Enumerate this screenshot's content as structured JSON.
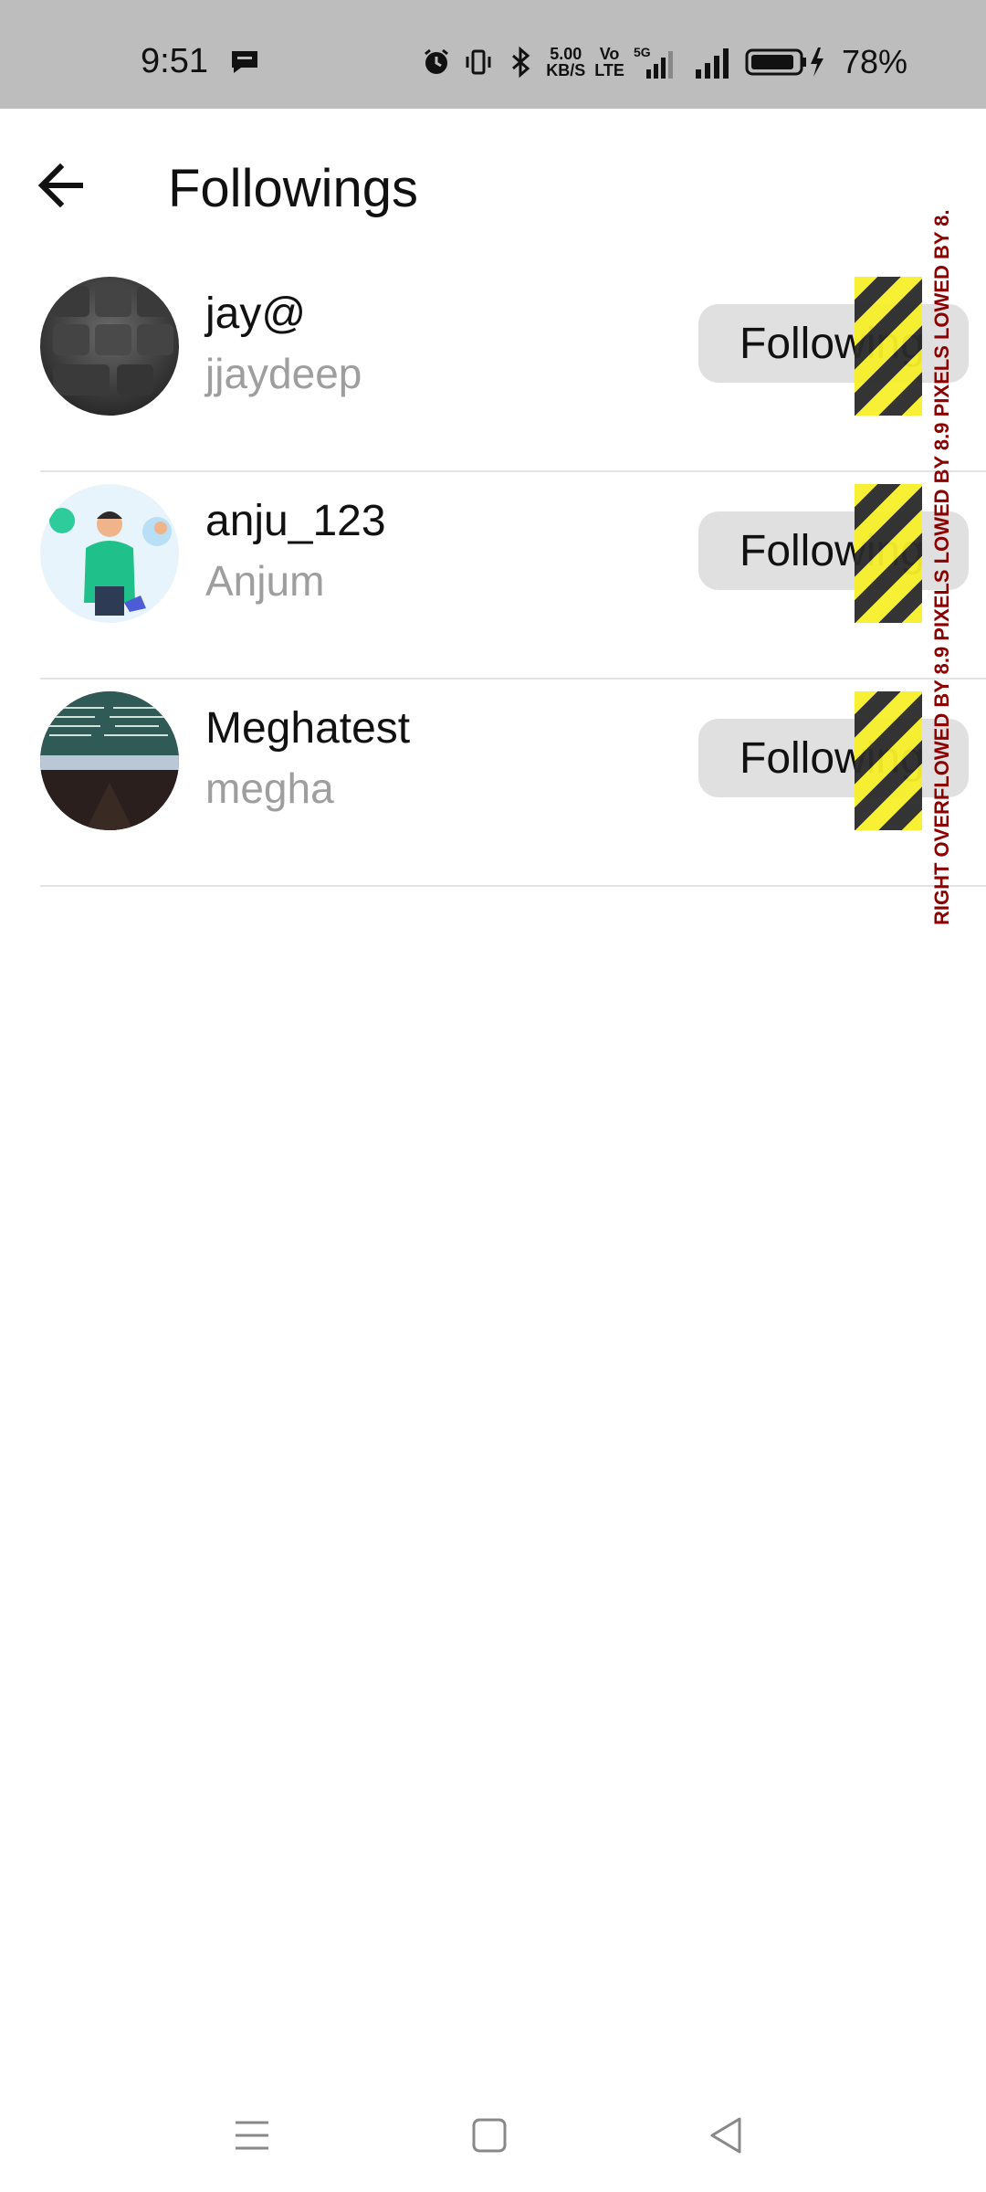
{
  "status_bar": {
    "time": "9:51",
    "speed_top": "5.00",
    "speed_bottom": "KB/S",
    "volte_top": "Vo",
    "volte_bottom": "LTE",
    "network": "5G",
    "battery_pct": "78%"
  },
  "header": {
    "title": "Followings"
  },
  "followings": [
    {
      "username": "jay@",
      "display_name": "jjaydeep",
      "button": "Following"
    },
    {
      "username": "anju_123",
      "display_name": "Anjum",
      "button": "Following"
    },
    {
      "username": "Meghatest",
      "display_name": "megha",
      "button": "Following"
    }
  ],
  "debug_overflow": {
    "text": "RIGHT OVERFLOWED BY 8.9 PIXELS LOWED BY 8.9 PIXELS LOWED BY 8."
  },
  "nav": {
    "menu_icon": "menu-icon",
    "home_icon": "square-icon",
    "back_icon": "triangle-back-icon"
  }
}
